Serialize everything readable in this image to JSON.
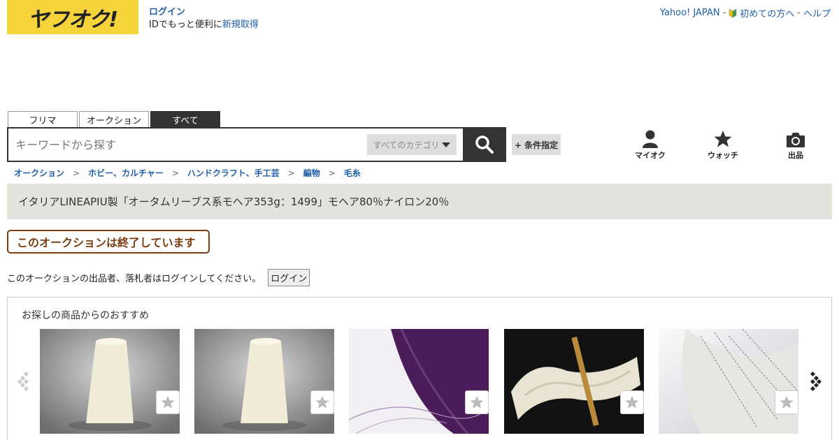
{
  "header": {
    "logo": "ヤフオク!",
    "login_link": "ログイン",
    "login_sub_prefix": "IDでもっと便利に",
    "signup_link": "新規取得",
    "links": {
      "yahoo_japan": "Yahoo! JAPAN",
      "beginner": "初めての方へ",
      "help": "ヘルプ",
      "separator": "-"
    }
  },
  "tabs": [
    {
      "label": "フリマ",
      "active": false
    },
    {
      "label": "オークション",
      "active": false
    },
    {
      "label": "すべて",
      "active": true
    }
  ],
  "search": {
    "placeholder": "キーワードから探す",
    "category": "すべてのカテゴリ",
    "condition_button": "+ 条件指定"
  },
  "utility": [
    {
      "label": "マイオク",
      "icon": "person-icon"
    },
    {
      "label": "ウォッチ",
      "icon": "star-icon"
    },
    {
      "label": "出品",
      "icon": "camera-icon"
    }
  ],
  "breadcrumb": [
    "オークション",
    "ホビー、カルチャー",
    "ハンドクラフト、手工芸",
    "編物",
    "毛糸"
  ],
  "breadcrumb_sep": ">",
  "item_title": "イタリアLINEAPIU製「オータムリーブス系モヘア353g：1499」モヘア80％ナイロン20％",
  "ended_text": "このオークションは終了しています",
  "login_note": "このオークションの出品者、落札者はログインしてください。",
  "login_button": "ログイン",
  "recommend": {
    "title": "お探しの商品からのおすすめ",
    "items": [
      {
        "image": "cream-yarn-cone"
      },
      {
        "image": "cream-yarn-cone"
      },
      {
        "image": "purple-mohair-cone"
      },
      {
        "image": "cream-yarn-skein"
      },
      {
        "image": "white-fluffy-yarn"
      }
    ]
  },
  "colors": {
    "logo_bg": "#f6d33a",
    "link": "#1f5fa8",
    "ended": "#7a3e12",
    "title_bg": "#e3e2dc"
  }
}
